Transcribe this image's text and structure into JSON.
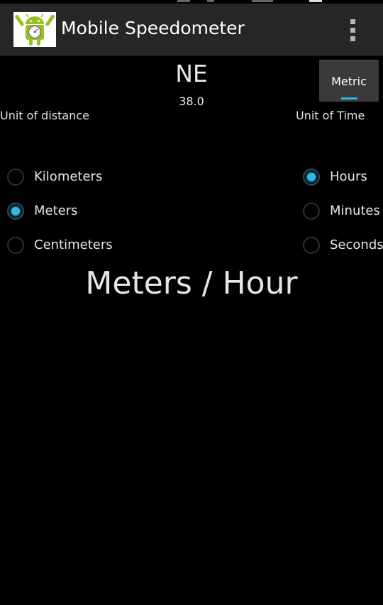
{
  "app": {
    "title": "Mobile Speedometer",
    "icon": "android-speedometer-icon",
    "menu_icon": "overflow-menu-icon"
  },
  "heading": {
    "direction": "NE",
    "degrees": "38.0"
  },
  "mode_button": {
    "label": "Metric"
  },
  "distance": {
    "label": "Unit of distance",
    "options": [
      {
        "label": "Kilometers",
        "checked": false
      },
      {
        "label": "Meters",
        "checked": true
      },
      {
        "label": "Centimeters",
        "checked": false
      }
    ]
  },
  "time": {
    "label": "Unit of Time",
    "options": [
      {
        "label": "Hours",
        "checked": true
      },
      {
        "label": "Minutes",
        "checked": false
      },
      {
        "label": "Seconds",
        "checked": false
      }
    ]
  },
  "unit_display": "Meters / Hour",
  "colors": {
    "accent": "#33b5e5",
    "background": "#000000",
    "action_bar": "#262626",
    "text": "#e6e6e6"
  }
}
